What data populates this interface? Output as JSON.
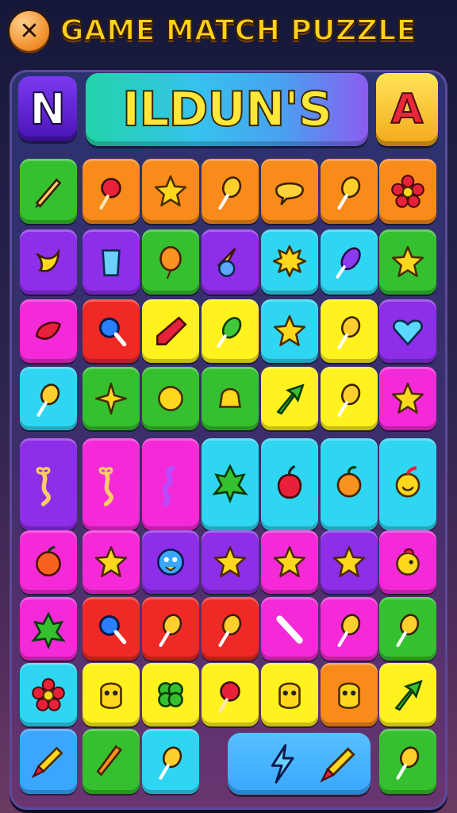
{
  "header": {
    "title": "GAME MATCH PUZZLE",
    "close_icon": "close-icon"
  },
  "word_row": {
    "left_letter": "N",
    "word": "ILDUN'S",
    "right_letter": "A"
  },
  "colors": {
    "green": "#35c12f",
    "orange": "#f98b1a",
    "purple": "#8d2ee8",
    "cyan": "#2fd6f2",
    "magenta": "#f42ad8",
    "red": "#ef2a26",
    "yellow": "#fff21e",
    "blue": "#3aa6ff"
  },
  "grid": {
    "rows": [
      [
        "green:pen-icon",
        "orange:candy-apple-icon",
        "orange:star-icon",
        "orange:lollipop-icon",
        "orange:speech-bubble-icon",
        "orange:lollipop-icon",
        "orange:flower-icon"
      ],
      [
        "purple:banana-icon",
        "purple:glass-icon",
        "green:balloon-icon",
        "purple:ice-cream-cone-icon",
        "cyan:sun-icon",
        "cyan:eggplant-icon",
        "green:star-icon"
      ],
      [
        "magenta:chili-icon",
        "red:magnifier-icon",
        "yellow:crayon-icon",
        "yellow:pickle-icon",
        "cyan:star-icon",
        "yellow:lollipop-icon",
        "purple:heart-icon"
      ],
      [
        "cyan:lollipop-icon",
        "green:spark-icon",
        "green:coin-icon",
        "green:bell-icon",
        "yellow:arrow-icon",
        "yellow:lollipop-icon",
        "magenta:star-icon"
      ],
      [
        "purple:bow-rope-icon",
        "magenta:bow-rope-icon",
        "magenta:rope-icon",
        "cyan:leaf-icon",
        "cyan:berry-icon",
        "cyan:fruit-icon",
        "cyan:smiley-fruit-icon"
      ],
      [
        "magenta:peach-icon",
        "magenta:star-icon",
        "purple:face-icon",
        "purple:star-icon",
        "magenta:star-icon",
        "purple:star-icon",
        "magenta:bird-icon"
      ],
      [
        "magenta:leaf-icon",
        "red:magnifier-icon",
        "red:lollipop-icon",
        "red:lollipop-icon",
        "magenta:stick-icon",
        "magenta:lollipop-icon",
        "green:lollipop-icon"
      ],
      [
        "cyan:flower-icon",
        "yellow:critter-icon",
        "yellow:clover-icon",
        "yellow:candy-apple-icon",
        "yellow:critter-icon",
        "orange:critter-icon",
        "yellow:arrow-icon"
      ],
      [
        "blue:rocket-icon",
        "green:carrot-icon",
        "cyan:lollipop-icon",
        "",
        "",
        "",
        "green:lollipop-icon"
      ]
    ],
    "special": {
      "color": "blue",
      "icons": [
        "lightning-icon",
        "rocket-icon"
      ]
    }
  }
}
